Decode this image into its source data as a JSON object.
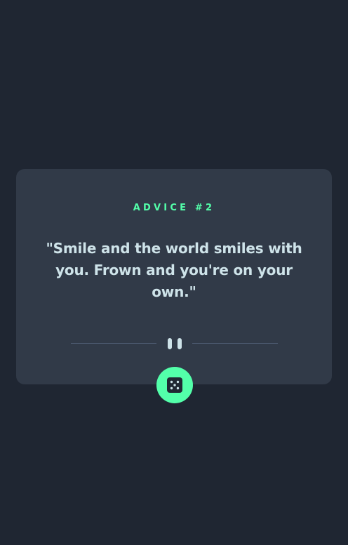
{
  "advice": {
    "label": "ADVICE #2",
    "quote": "\"Smile and the world smiles with you. Frown and you're on your own.\""
  },
  "icons": {
    "divider": "pause-icon",
    "button": "dice-icon"
  },
  "colors": {
    "background": "#1f2632",
    "card": "#313a48",
    "accent": "#53ffaa",
    "text": "#cee3e9",
    "divider": "#4f5d74"
  }
}
